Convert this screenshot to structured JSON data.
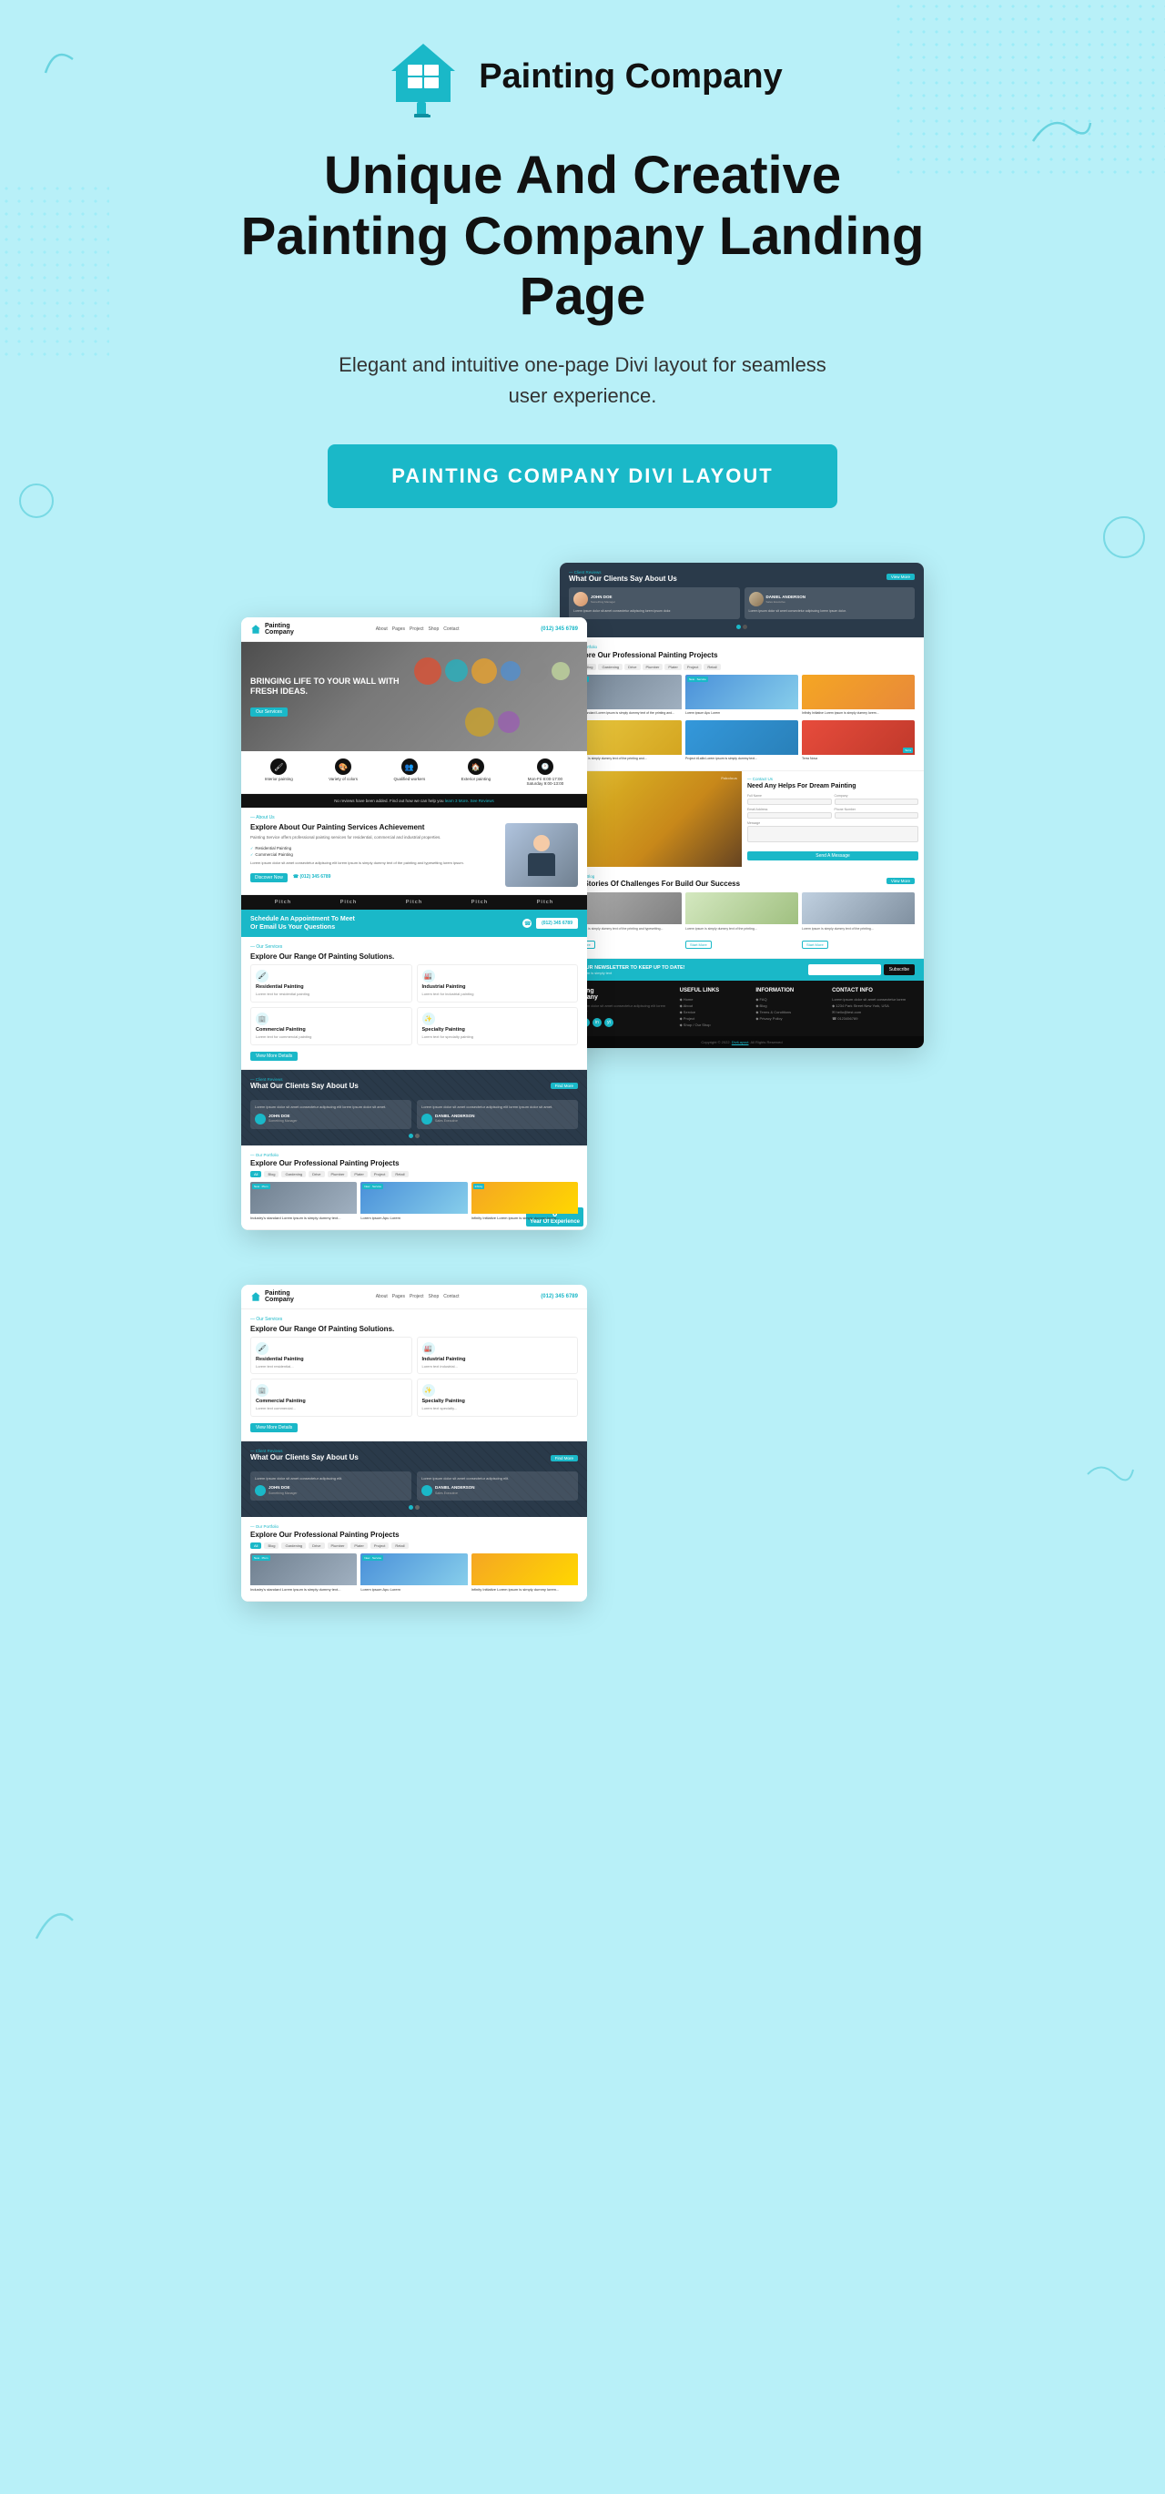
{
  "header": {
    "logo_text": "Painting\nCompany",
    "main_title": "Unique And Creative\nPainting Company Landing Page",
    "subtitle": "Elegant and intuitive one-page Divi layout for seamless user experience.",
    "cta_label": "PAINTING COMPANY DIVI  LAYOUT"
  },
  "mockup_left": {
    "nav": {
      "logo": "Painting Company",
      "links": [
        "About",
        "Pages",
        "Project",
        "Shop",
        "Contact"
      ],
      "phone": "(012) 345 6789"
    },
    "hero": {
      "title": "BRINGING LIFE TO YOUR WALL WITH FRESH IDEAS.",
      "btn": "Our Services"
    },
    "icons": [
      {
        "label": "Interior painting",
        "icon": "🖌"
      },
      {
        "label": "Variety of colors",
        "icon": "🎨"
      },
      {
        "label": "Qualified workers",
        "icon": "👥"
      },
      {
        "label": "Exterior painting",
        "icon": "🏠"
      },
      {
        "label": "Mon-Fri 8:00-17:00\nSaturday 9:00-13:00",
        "icon": "🕐"
      }
    ],
    "about": {
      "title": "Explore About Our Painting Services Achievement",
      "text": "Painting Service offers professional painting services for residential, commercial and industrial properties.",
      "checks": [
        "Residential Painting",
        "Commercial Painting"
      ],
      "stat": "0",
      "stat_label": "Year Of Experience",
      "phone": "(012) 345 6789"
    },
    "logos": [
      "Pitch",
      "Pitch",
      "Pitch",
      "Pitch",
      "Pitch"
    ],
    "appt": {
      "title": "Schedule An Appointment To Meet\nOr Email Us Your Questions",
      "btn": "(012) 345 6789"
    },
    "services": {
      "title": "Explore Our Range Of Painting Solutions.",
      "items": [
        {
          "title": "Residential Painting",
          "text": "Lorem text for residential painting services description"
        },
        {
          "title": "Industrial Painting",
          "text": "Lorem text for industrial painting services description"
        },
        {
          "title": "Commercial Painting",
          "text": "Lorem text for commercial painting services description"
        },
        {
          "title": "Specialty Painting",
          "text": "Lorem text for specialty painting services description"
        }
      ],
      "btn": "View More Details"
    },
    "testimonials": {
      "title": "What Our Clients Say About Us",
      "btn": "Find More",
      "cards": [
        {
          "text": "Lorem ipsum dolor sit amet consectetur adipiscing elit...",
          "name": "JOHN DOE",
          "role": "Something Manager"
        },
        {
          "text": "Lorem ipsum dolor sit amet consectetur adipiscing elit...",
          "name": "DANIEL ANDERSON",
          "role": "Sales Executive"
        }
      ]
    },
    "projects": {
      "title": "Explore Our Professional Painting Projects",
      "filters": [
        "All",
        "Blog",
        "Gardening",
        "Drive",
        "Plumber",
        "Plater",
        "Project",
        "Retail"
      ],
      "items": [
        {
          "tag": "New",
          "label": "Industry's standard Lorem ipsum is simply dummy text..."
        },
        {
          "tag": "New",
          "label": "Lorem ipsum Apu Lorem"
        },
        {
          "tag": "Infinity",
          "label": "Infinity Initiative Lorem ipsum is simply dummy lorem..."
        }
      ]
    }
  },
  "mockup_right": {
    "testimonials": {
      "title": "What Our Clients Say About Us",
      "btn": "View More",
      "cards": [
        {
          "text": "Lorem ipsum dolor sit amet consectetur...",
          "name": "JOHN DOE",
          "role": "Something Manager"
        },
        {
          "text": "Lorem ipsum dolor sit amet consectetur...",
          "name": "DANIEL ANDERSON",
          "role": "Sales Executive"
        }
      ]
    },
    "projects": {
      "title": "Explore Our Professional Painting Projects",
      "filters": [
        "All",
        "Blog",
        "Gardening",
        "Drive",
        "Plumber",
        "Plater",
        "Project",
        "Retail"
      ],
      "items": [
        {
          "tag": "New · Plum",
          "label": "Industry's standard Lorem ipsum is simply dummy text of the printing and..."
        },
        {
          "tag": "New · Service",
          "label": "Lorem ipsum Apu Lorem"
        },
        {
          "tag": "",
          "label": "Infinity Initiative Lorem ipsum is simply dummy lorem..."
        },
        {
          "tag": "",
          "label": "Lorem ipsum is simply dummy text of the printing and..."
        },
        {
          "tag": "",
          "label": "Project #1alfa Lorem ipsum is simply dummy text of the printing..."
        },
        {
          "tag": "Terra",
          "label": "Terra Nova"
        }
      ]
    },
    "contact": {
      "title": "Need Any Helps For Dream Painting",
      "fields": [
        "Full Name",
        "Company",
        "Email Address",
        "Phone Number",
        "Message"
      ],
      "btn": "Send A Message"
    },
    "stories": {
      "title": "The Stories Of Challenges For Build Our Success",
      "btn": "View More",
      "items": [
        {
          "text": "Lorem ipsum is simply dummy text of the printing and typesetting..."
        },
        {
          "text": "Lorem ipsum is simply dummy text of the printing..."
        },
        {
          "text": "Lorem ipsum is simply dummy text of the printing..."
        }
      ],
      "btns": [
        "Start More",
        "Start More",
        "Start More"
      ]
    },
    "newsletter": {
      "title": "JOIN OUR NEWSLETTER TO KEEP UP TO DATE!",
      "sub": "Lorem ipsum is simply text",
      "placeholder": "Email",
      "btn": "Subscribe"
    },
    "footer": {
      "logo": "Painting\nCompany",
      "about": "Lorem ipsum dolor sit amet consectetur adipiscing elit lorem ipsum dolor",
      "useful_links": {
        "title": "USEFUL LINKS",
        "items": [
          "Home",
          "About",
          "Service",
          "Project",
          "Shop / Our Shop"
        ]
      },
      "information": {
        "title": "INFORMATION",
        "items": [
          "FAQ",
          "Blog",
          "Terms & Conditions",
          "Privacy Policy"
        ]
      },
      "contact": {
        "title": "CONTACT INFO",
        "items": [
          "Lorem ipsum dolor sit amet consectetur lorem ipsum",
          "1234 Park Street New York, USA",
          "hello@test.com",
          "0123456789"
        ]
      },
      "copyright": "Copyright © 2022. DiviLayout, All Rights Reserved"
    }
  },
  "colors": {
    "teal": "#1ab8c8",
    "dark": "#111111",
    "light_bg": "#b8f0f8",
    "white": "#ffffff",
    "gray": "#888888"
  }
}
